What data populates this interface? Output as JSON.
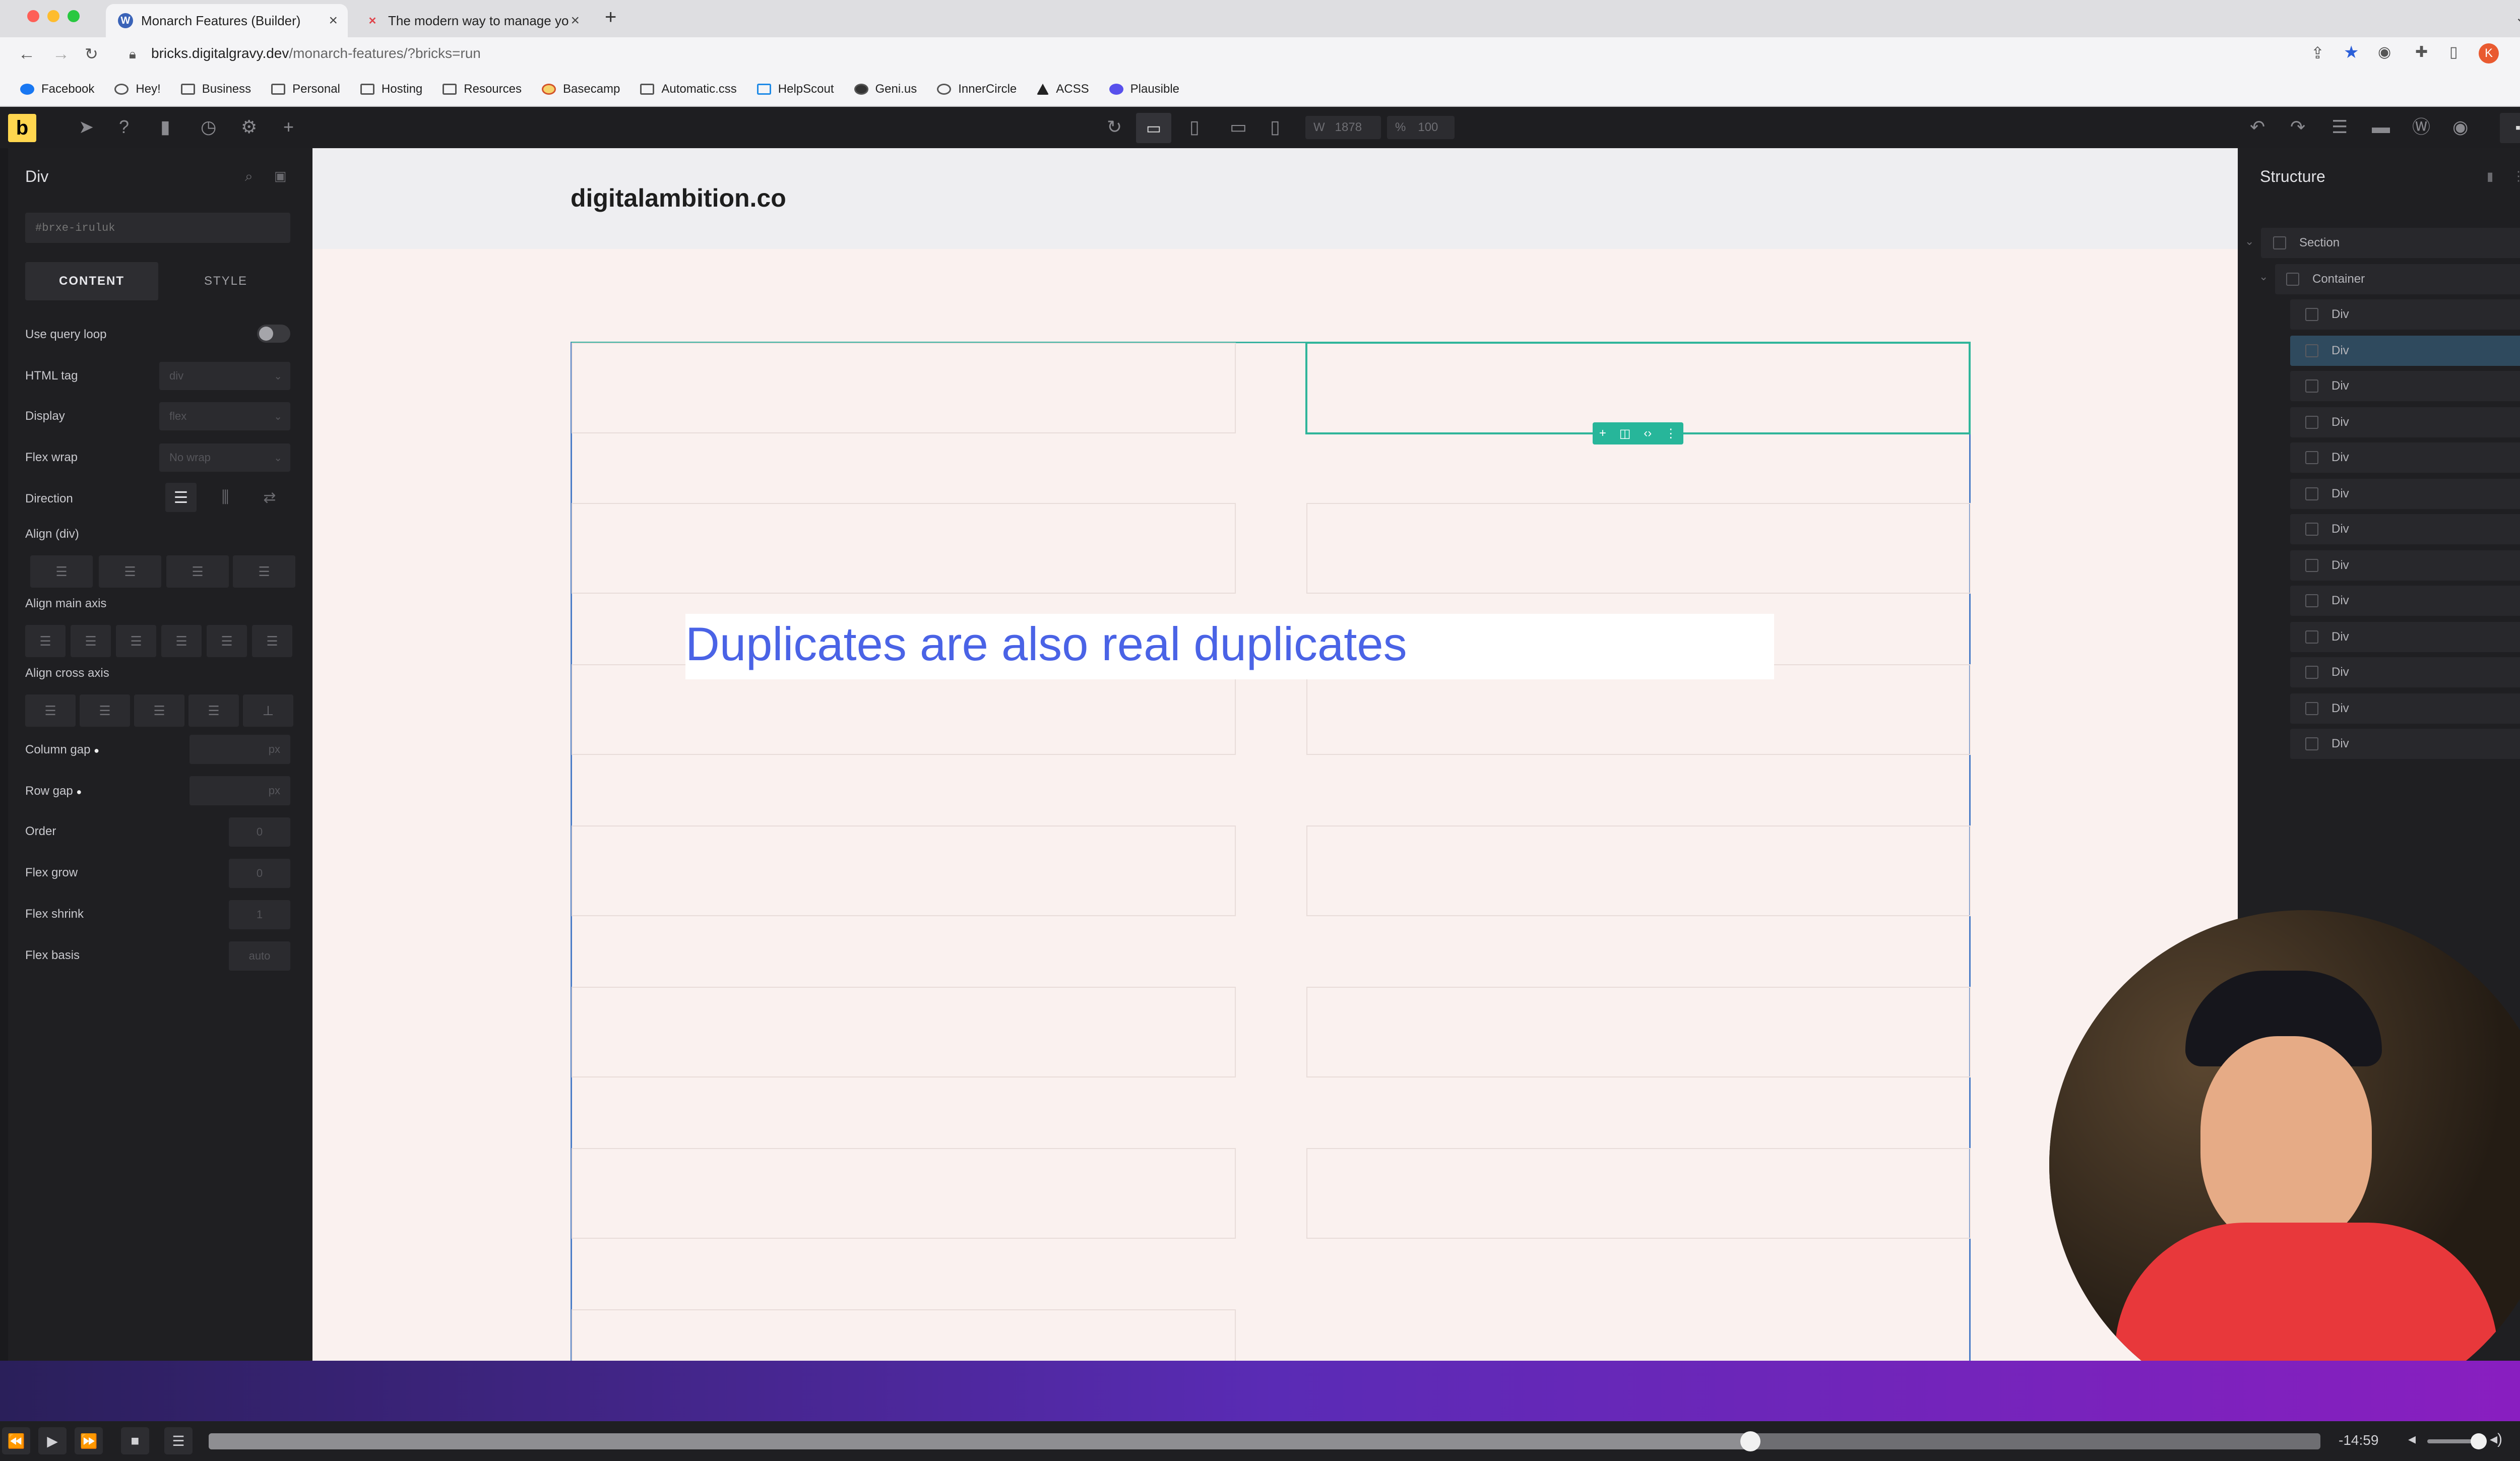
{
  "browser": {
    "tabs": [
      {
        "title": "Monarch Features (Builder)",
        "active": true
      },
      {
        "title": "The modern way to manage yo",
        "active": false
      }
    ],
    "url_host": "bricks.digitalgravy.dev",
    "url_path": "/monarch-features/?bricks=run",
    "profile_initial": "K",
    "bookmarks": [
      "Facebook",
      "Hey!",
      "Business",
      "Personal",
      "Hosting",
      "Resources",
      "Basecamp",
      "Automatic.css",
      "HelpScout",
      "Geni.us",
      "InnerCircle",
      "ACSS",
      "Plausible"
    ]
  },
  "builder": {
    "logo": "b",
    "width_label": "W",
    "width_value": "1878",
    "zoom_label": "%",
    "zoom_value": "100"
  },
  "left_panel": {
    "element_title": "Div",
    "selector_placeholder": "#brxe-iruluk",
    "tab_content": "CONTENT",
    "tab_style": "STYLE",
    "use_query_loop": "Use query loop",
    "html_tag": {
      "label": "HTML tag",
      "value": "div"
    },
    "display": {
      "label": "Display",
      "value": "flex"
    },
    "flex_wrap": {
      "label": "Flex wrap",
      "value": "No wrap"
    },
    "direction": "Direction",
    "align_div": "Align (div)",
    "align_main_axis": "Align main axis",
    "align_cross_axis": "Align cross axis",
    "column_gap": {
      "label": "Column gap",
      "unit": "px"
    },
    "row_gap": {
      "label": "Row gap",
      "unit": "px"
    },
    "order": {
      "label": "Order",
      "value": "0"
    },
    "flex_grow": {
      "label": "Flex grow",
      "value": "0"
    },
    "flex_shrink": {
      "label": "Flex shrink",
      "value": "1"
    },
    "flex_basis": {
      "label": "Flex basis",
      "value": "auto"
    }
  },
  "canvas": {
    "site_logo": "digitalambition.co",
    "overlay_text": "Duplicates are also real duplicates"
  },
  "structure": {
    "title": "Structure",
    "section": "Section",
    "container": "Container",
    "divs": [
      "Div",
      "Div",
      "Div",
      "Div",
      "Div",
      "Div",
      "Div",
      "Div",
      "Div",
      "Div",
      "Div",
      "Div",
      "Div"
    ]
  },
  "player": {
    "time_remaining": "-14:59",
    "progress": 0.73
  }
}
